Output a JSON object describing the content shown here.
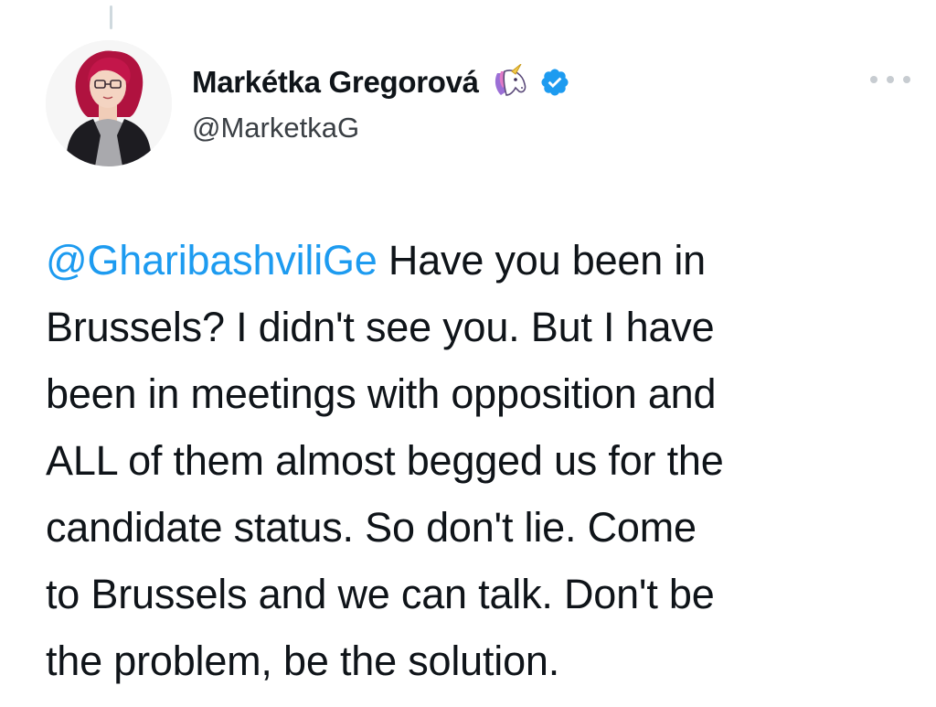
{
  "tweet": {
    "author": {
      "display_name": "Markétka Gregorová",
      "handle": "@MarketkaG",
      "emoji_icon": "unicorn-icon",
      "verified_icon": "verified-badge-icon"
    },
    "text": {
      "mention": "@GharibashviliGe",
      "line1_rest": " Have you been in",
      "line2": "Brussels? I didn't see you. But I have",
      "line3": "been in meetings with opposition and",
      "line4": "ALL of them almost begged us for the",
      "line5": "candidate status. So don't lie. Come",
      "line6": "to Brussels and we can talk. Don't be",
      "line7": "the problem, be the solution."
    },
    "colors": {
      "mention": "#1d9bf0",
      "verified": "#1d9bf0",
      "text": "#0f1419",
      "secondary": "#536471"
    }
  }
}
